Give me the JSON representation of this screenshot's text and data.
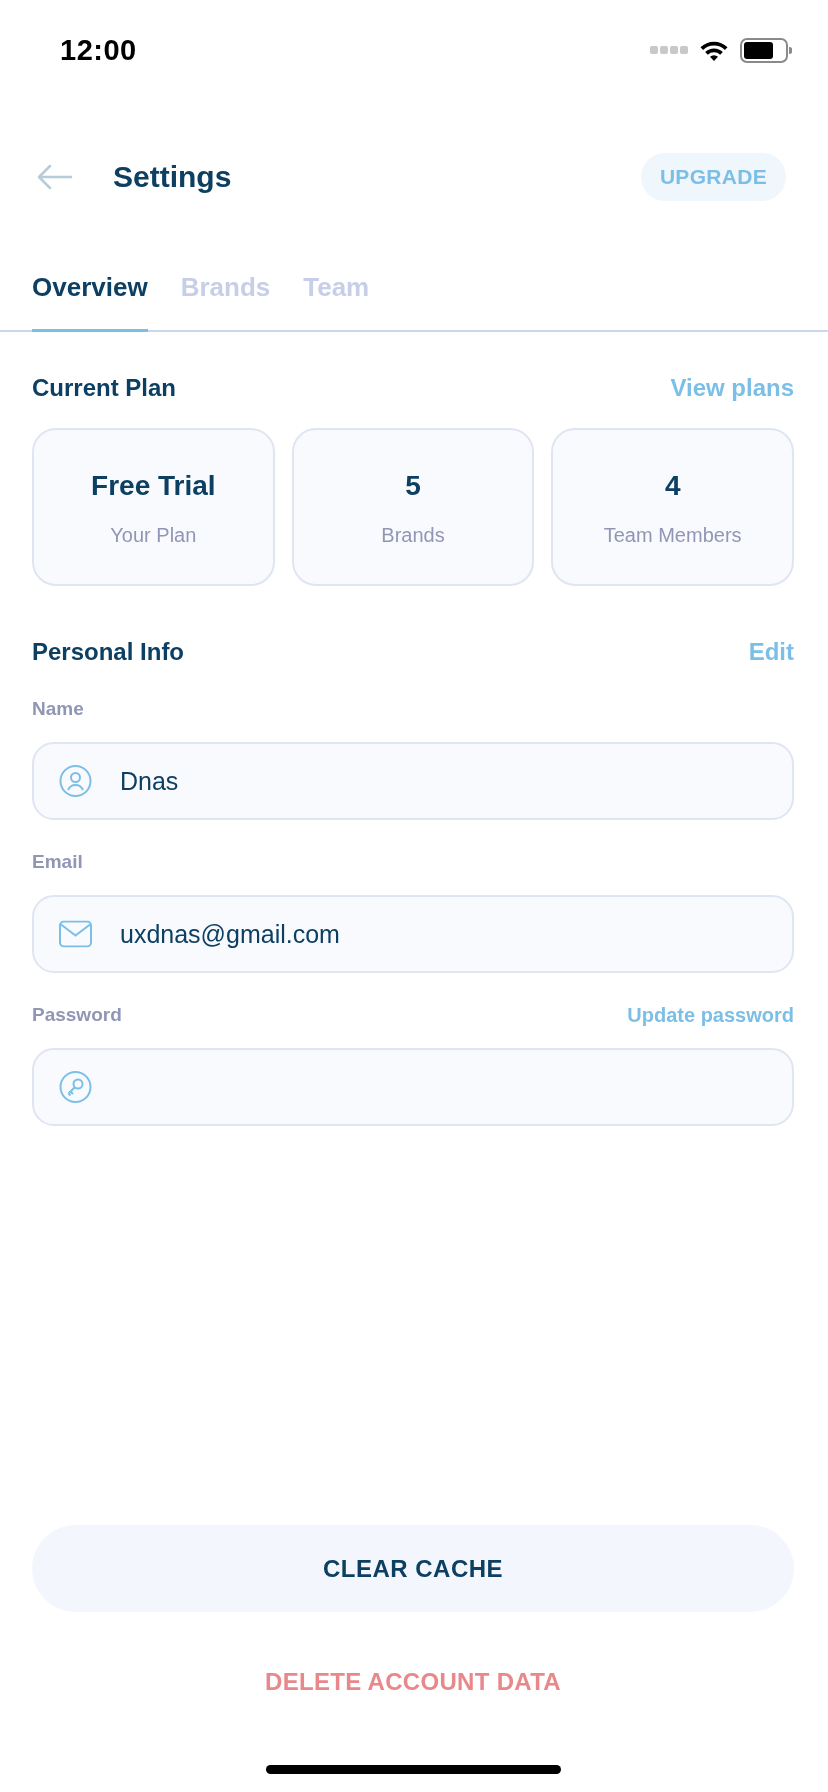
{
  "status_bar": {
    "time": "12:00"
  },
  "header": {
    "title": "Settings",
    "action": "UPGRADE"
  },
  "tabs": [
    {
      "label": "Overview",
      "selected": true
    },
    {
      "label": "Brands",
      "selected": false
    },
    {
      "label": "Team",
      "selected": false
    }
  ],
  "current_plan": {
    "heading": "Current Plan",
    "link": "View plans",
    "cards": [
      {
        "value": "Free Trial",
        "label": "Your Plan"
      },
      {
        "value": "5",
        "label": "Brands"
      },
      {
        "value": "4",
        "label": "Team Members"
      }
    ]
  },
  "personal_info": {
    "heading": "Personal Info",
    "link": "Edit",
    "fields": [
      {
        "kind": "name",
        "label": "Name",
        "value": "Dnas"
      },
      {
        "kind": "email",
        "label": "Email",
        "value": "uxdnas@gmail.com"
      },
      {
        "kind": "password",
        "label": "Password",
        "link": "Update password"
      }
    ]
  },
  "actions": {
    "clear": "CLEAR CACHE",
    "delete": "DELETE ACCOUNT DATA"
  }
}
